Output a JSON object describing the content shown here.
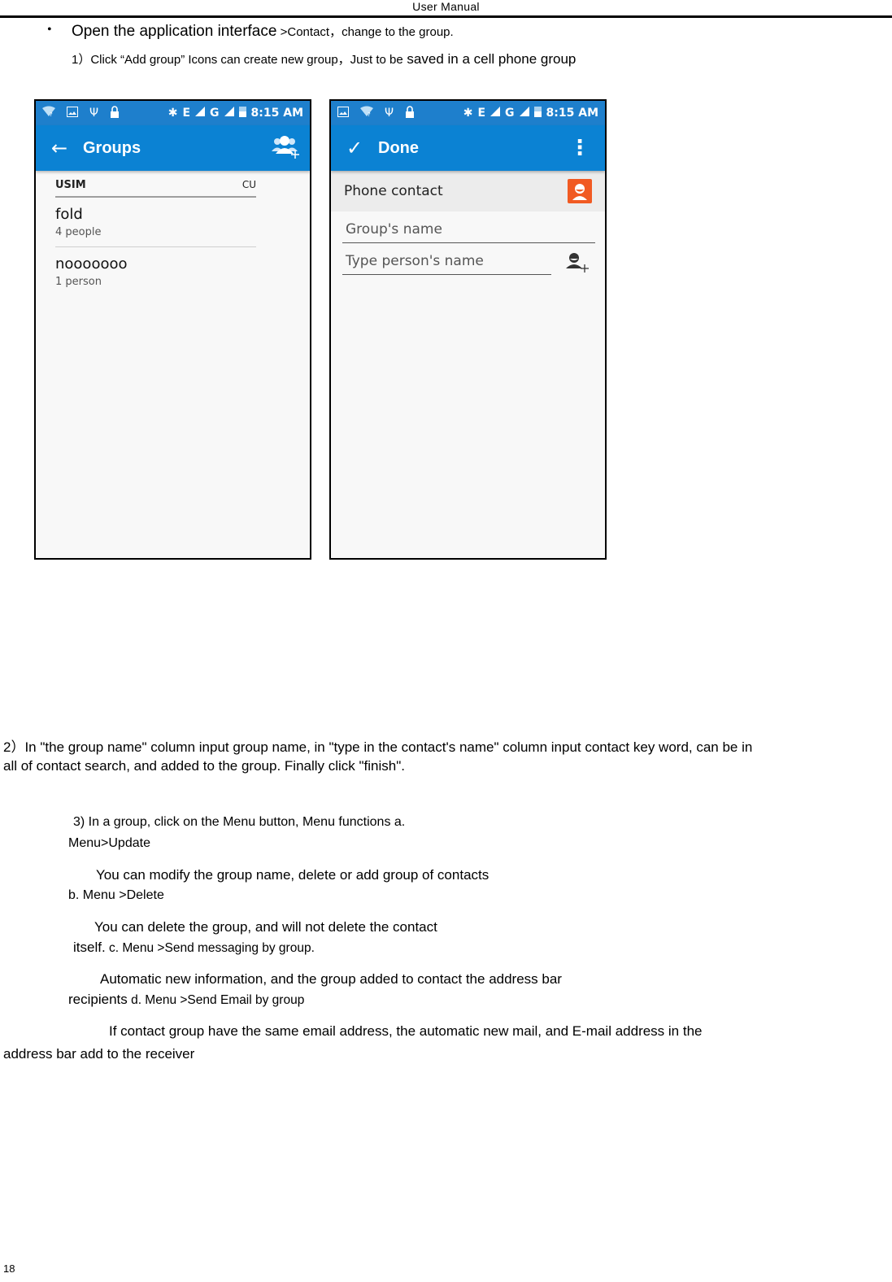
{
  "header": {
    "title": "User    Manual"
  },
  "intro": {
    "bullet": "•",
    "line1_main": "Open the    application interface",
    "line1_tail": "    >Contact，change to the group.",
    "line2_head": "1）Click “Add group” Icons can create new group，Just to be",
    "line2_tail": " saved in a cell phone group"
  },
  "phone_left": {
    "status_bar": {
      "left_icons": [
        "wifi-question-icon",
        "image-icon",
        "usb-icon",
        "lock-icon"
      ],
      "network": "E",
      "network2": "G",
      "time": "8:15 AM"
    },
    "app_bar": {
      "title": "Groups",
      "nav_icon": "←"
    },
    "section": {
      "label": "USIM",
      "account": "CU"
    },
    "groups": [
      {
        "name": "fold",
        "count": "4 people"
      },
      {
        "name": "nooooooo",
        "count": "1 person"
      }
    ]
  },
  "phone_right": {
    "status_bar": {
      "left_icons": [
        "image-icon",
        "wifi-question-icon",
        "usb-icon",
        "lock-icon"
      ],
      "network": "E",
      "network2": "G",
      "time": "8:15 AM"
    },
    "app_bar": {
      "title": "Done",
      "nav_icon": "✓",
      "menu_icon": "⋮"
    },
    "account_row": {
      "label": "Phone contact"
    },
    "group_name_field": {
      "placeholder": "Group's name"
    },
    "person_field": {
      "placeholder": "Type person's name"
    }
  },
  "colors": {
    "status_bar": "#1e7fcc",
    "app_bar": "#0b82d3",
    "account_avatar": "#f15a22"
  },
  "body": {
    "step2_line1": "2）In \"the group name\" column input group name, in \"type in the contact's name\" column input contact key word, can be in",
    "step2_line2": "all of contact search, and added to the group. Finally click \"finish\".",
    "step3_line1": "3) In a group, click on the Menu button, Menu functions a.",
    "step3_line2": "Menu>Update",
    "update_desc": "You can modify the group name, delete or add group of contacts",
    "delete_title": "b. Menu >Delete",
    "delete_desc": "You can delete the group, and will not delete the contact",
    "delete_desc_tail": "itself.",
    "send_msg_title": " c. Menu >Send messaging by group.",
    "send_msg_desc": "Automatic new information, and the group added to contact the address bar",
    "send_msg_tail": "recipients",
    "send_email_title": " d. Menu >Send Email by group",
    "send_email_desc": "If contact group have the same email address, the automatic new mail, and E-mail address in the",
    "send_email_desc2": "address bar add to the receiver"
  },
  "footer": {
    "page_number": "18"
  }
}
